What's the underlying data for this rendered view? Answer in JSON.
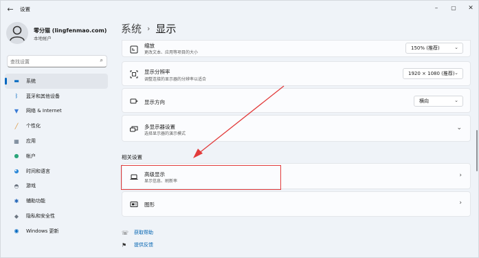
{
  "titlebar": {
    "back_glyph": "←",
    "title": "设置",
    "minimize_glyph": "–",
    "maximize_glyph": "▢",
    "close_glyph": "✕"
  },
  "profile": {
    "name": "零分猫 (lingfenmao.com)",
    "subtitle": "本地帐户"
  },
  "search": {
    "placeholder": "查找设置",
    "value": "",
    "icon": "search-icon"
  },
  "nav": {
    "items": [
      {
        "label": "系统",
        "icon": "monitor-icon",
        "glyph": "▬",
        "color": "#0067c0",
        "selected": true
      },
      {
        "label": "蓝牙和其他设备",
        "icon": "bluetooth-icon",
        "glyph": "ᛒ",
        "color": "#0067c0"
      },
      {
        "label": "网络 & Internet",
        "icon": "wifi-icon",
        "glyph": "▼",
        "color": "#3a7bd5"
      },
      {
        "label": "个性化",
        "icon": "brush-icon",
        "glyph": "╱",
        "color": "#d98b2b"
      },
      {
        "label": "应用",
        "icon": "apps-icon",
        "glyph": "▦",
        "color": "#5b6c80"
      },
      {
        "label": "帐户",
        "icon": "person-icon",
        "glyph": "●",
        "color": "#2aa57a"
      },
      {
        "label": "时间和语言",
        "icon": "globe-icon",
        "glyph": "◕",
        "color": "#2b88d8"
      },
      {
        "label": "游戏",
        "icon": "gamepad-icon",
        "glyph": "◓",
        "color": "#6d7682"
      },
      {
        "label": "辅助功能",
        "icon": "accessibility-icon",
        "glyph": "✱",
        "color": "#1a5fb4"
      },
      {
        "label": "隐私和安全性",
        "icon": "shield-icon",
        "glyph": "◆",
        "color": "#6d7682"
      },
      {
        "label": "Windows 更新",
        "icon": "update-icon",
        "glyph": "◉",
        "color": "#0067c0"
      }
    ]
  },
  "breadcrumb": {
    "parent": "系统",
    "separator": "›",
    "current": "显示"
  },
  "cards": {
    "scale": {
      "title": "缩放",
      "subtitle": "更改文本、应用等项目的大小",
      "value": "150% (推荐)",
      "icon": "scale-icon"
    },
    "resolution": {
      "title": "显示分辨率",
      "subtitle": "调整连接的显示器的分辨率以适合",
      "value": "1920 × 1080 (推荐)",
      "icon": "resolution-icon"
    },
    "orientation": {
      "title": "显示方向",
      "value": "横向",
      "icon": "orientation-icon"
    },
    "multi_display": {
      "title": "多显示器设置",
      "subtitle": "选择显示器的演示模式",
      "icon": "multi-display-icon"
    }
  },
  "related": {
    "heading": "相关设置",
    "advanced": {
      "title": "高级显示",
      "subtitle": "显示信息、刷新率",
      "icon": "laptop-icon"
    },
    "graphics": {
      "title": "图形",
      "icon": "graphics-icon"
    }
  },
  "links": {
    "help": "获取帮助",
    "feedback": "提供反馈"
  },
  "annotation": {
    "color": "#e23b3b"
  }
}
